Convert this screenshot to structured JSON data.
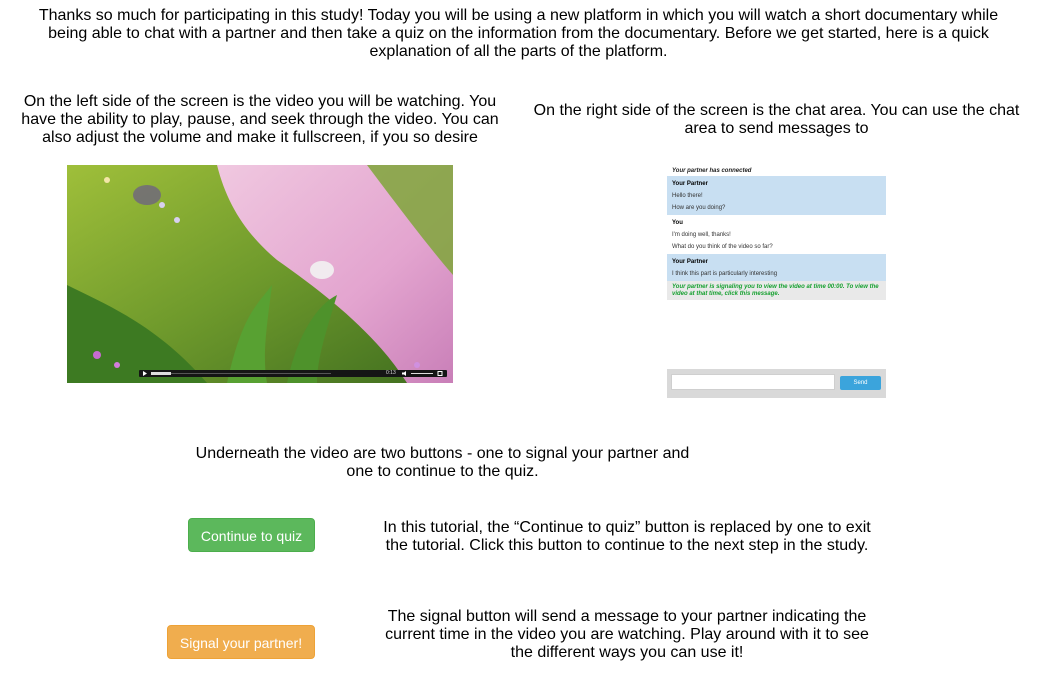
{
  "intro": "Thanks so much for participating in this study! Today you will be using a new platform in which you will watch a short documentary while being able to chat with a partner and then take a quiz on the information from the documentary. Before we get started, here is a quick explanation of all the parts of the platform.",
  "left_description": "On the left side of the screen is the video you will be watching. You have the ability to play, pause, and seek through the video. You can also adjust the volume and make it fullscreen, if you so desire",
  "right_description": "On the right side of the screen is the chat area. You can use the chat area to send messages to",
  "video": {
    "time_label": "0:13"
  },
  "chat": {
    "status": "Your partner has connected",
    "blocks": [
      {
        "who": "Your Partner",
        "messages": [
          "Hello there!",
          "How are you doing?"
        ]
      },
      {
        "who": "You",
        "messages": [
          "I'm doing well, thanks!",
          "What do you think of the video so far?"
        ]
      },
      {
        "who": "Your Partner",
        "messages": [
          "I think this part is particularly interesting"
        ]
      }
    ],
    "signal_message": "Your partner is signaling you to view the video at time 00:00. To view the video at that time, click this message.",
    "send_label": "Send"
  },
  "below_description": "Underneath the video are two buttons - one to signal your partner and one to continue to the quiz.",
  "continue_button": "Continue to quiz",
  "quiz_description": "In this tutorial, the “Continue to quiz” button is replaced by one to exit the tutorial. Click this button to continue to the next step in the study.",
  "signal_button": "Signal your partner!",
  "signal_description": "The signal button will send a message to your partner indicating the current time in the video you are watching. Play around with it to see the different ways you can use it!",
  "colors": {
    "continue": "#5cb85c",
    "signal": "#f0ad4e",
    "send": "#3ba4dc",
    "chat_partner_bg": "#c8dff2",
    "signal_text": "#15a02f"
  }
}
